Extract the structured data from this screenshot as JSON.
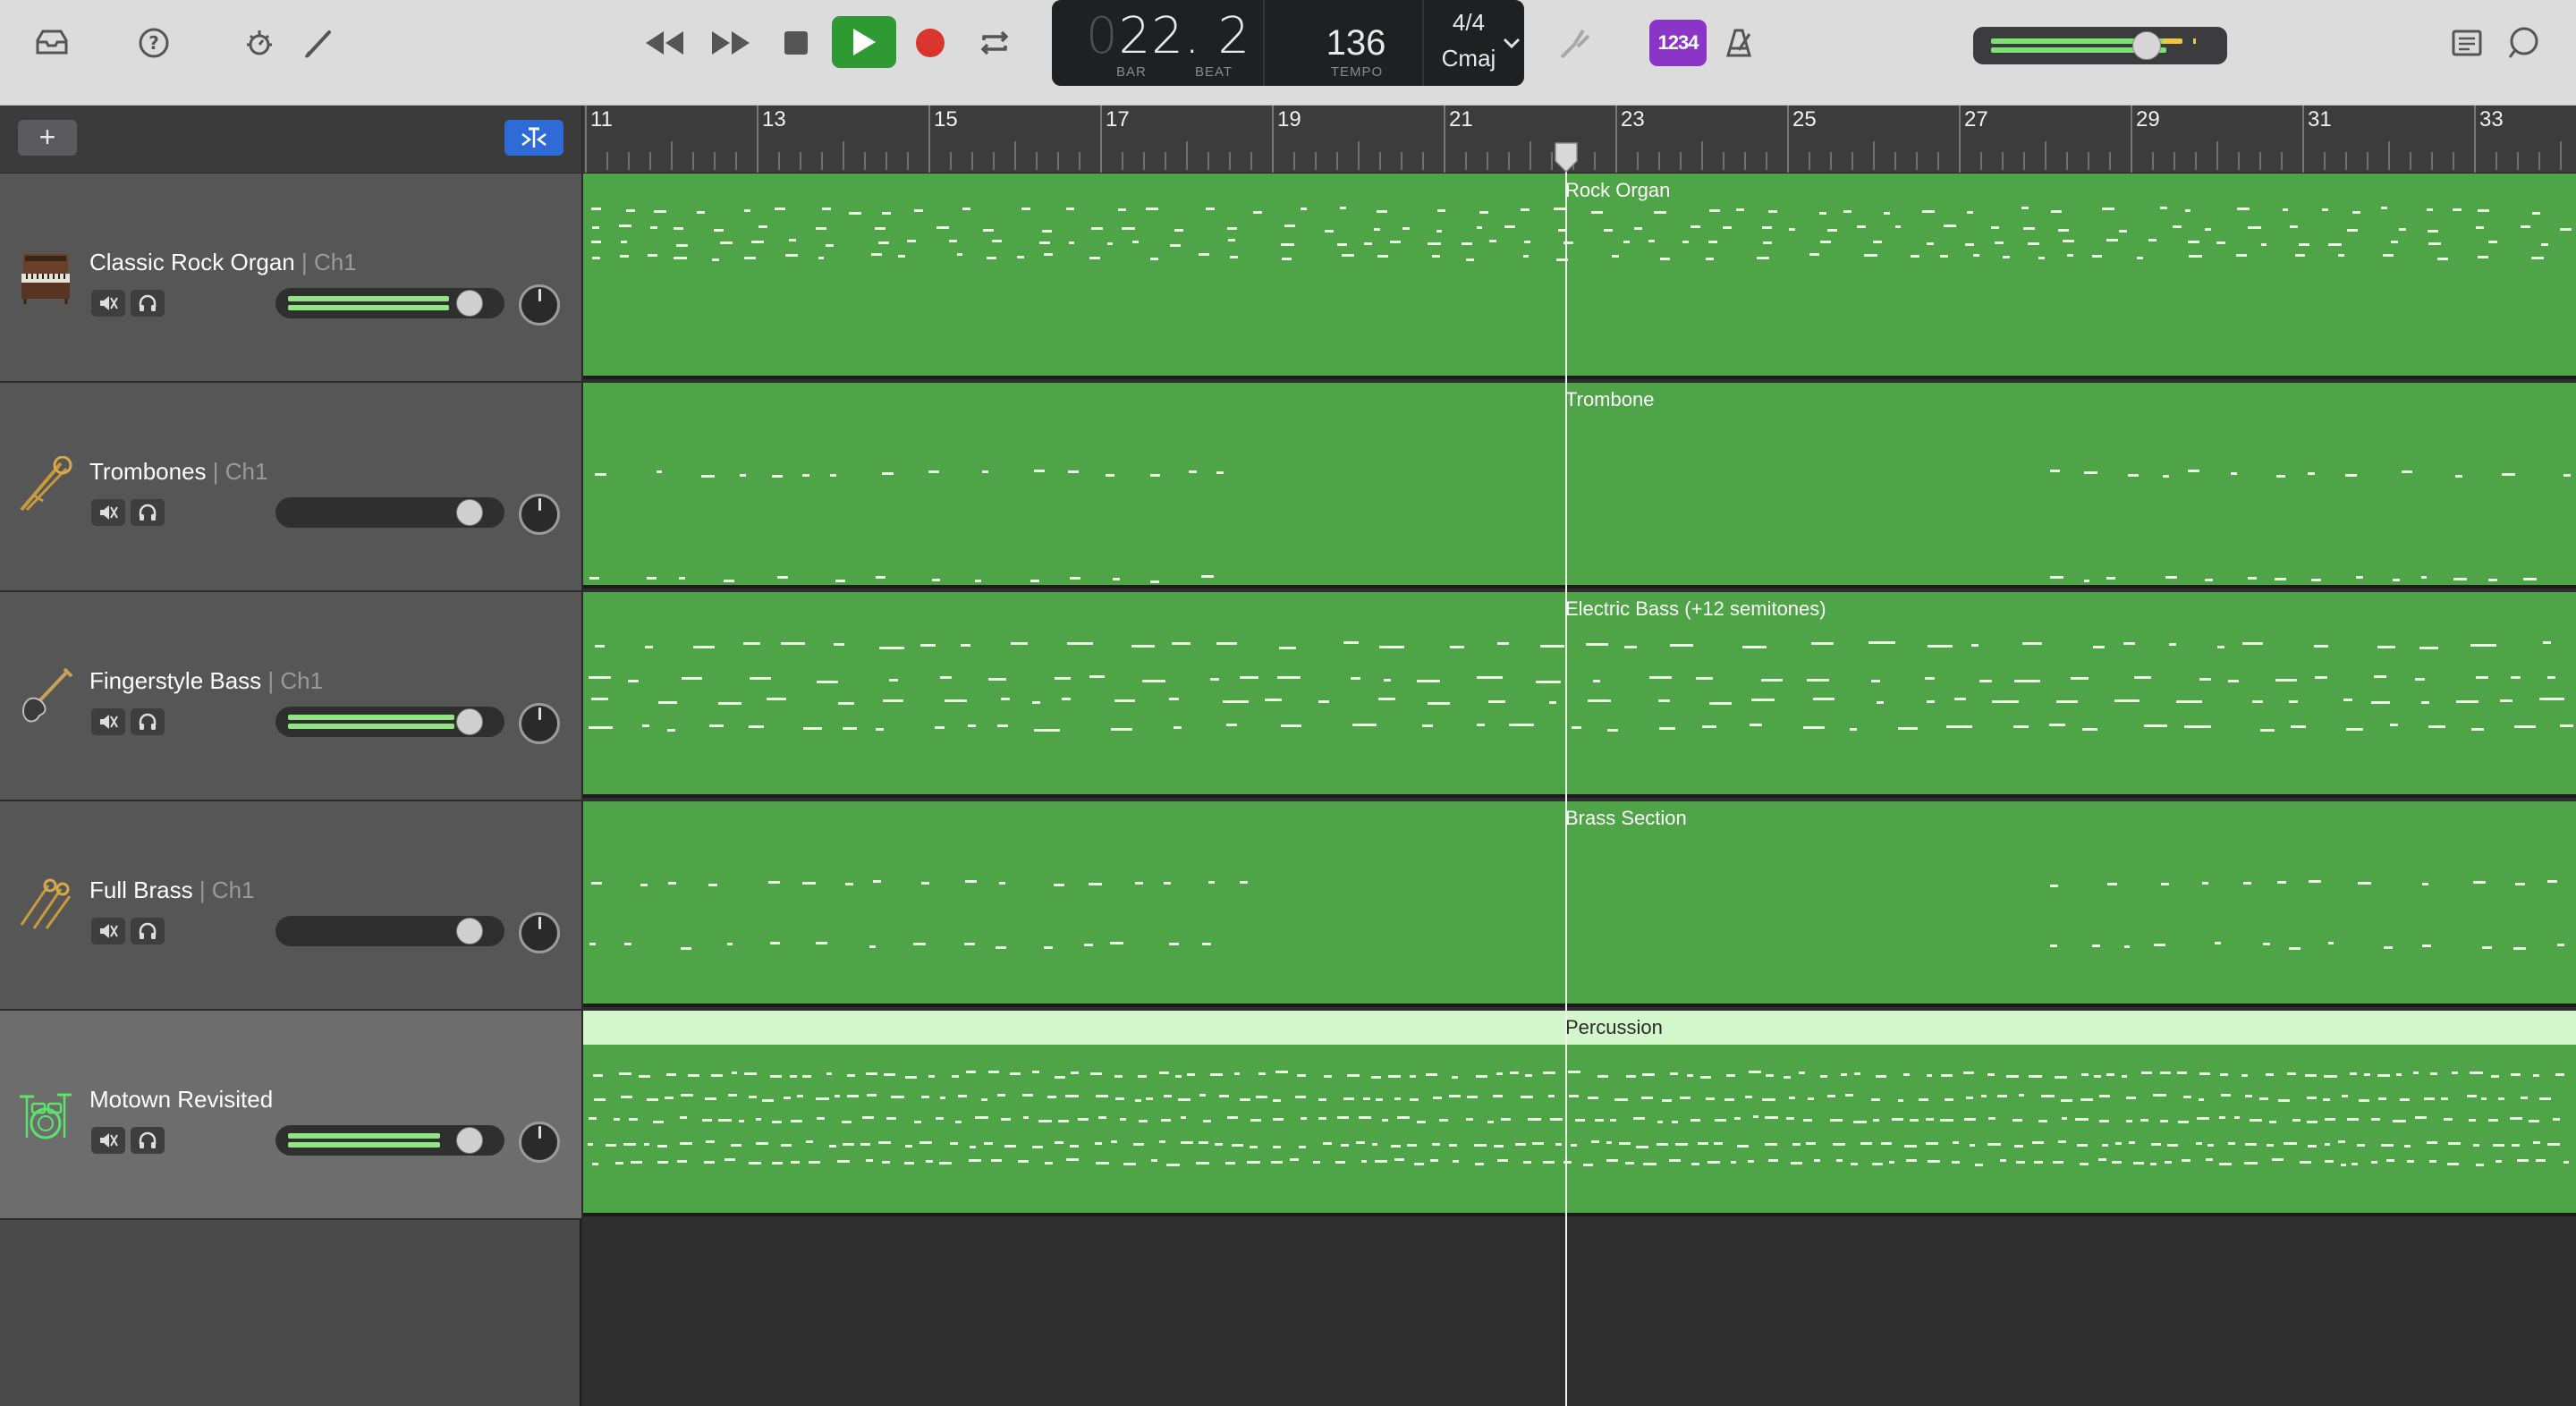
{
  "control_bar": {
    "icons": [
      "library-icon",
      "help-icon",
      "smart-controls-icon",
      "editors-icon",
      "rewind-icon",
      "fast-forward-icon",
      "stop-icon",
      "play-icon",
      "record-icon",
      "cycle-icon",
      "tuner-icon",
      "metronome-icon",
      "notepad-icon",
      "loops-icon"
    ],
    "lcd": {
      "bar_dim": "0",
      "position": "22. 2",
      "bar_label": "BAR",
      "beat_label": "BEAT",
      "tempo": "136",
      "tempo_label": "TEMPO",
      "time_signature": "4/4",
      "key": "Cmaj"
    },
    "count_in": "1234",
    "accent_color": "#8a35c7",
    "play_color": "#2f9a34",
    "record_color": "#d9352d",
    "master_volume_level": 0.71
  },
  "tracks_header": {
    "add_button": "+"
  },
  "tracks": [
    {
      "name": "Classic Rock Organ",
      "channel": "| Ch1",
      "icon": "organ-icon",
      "volume_level": 0.88,
      "meter": 0.83,
      "selected": false
    },
    {
      "name": "Trombones",
      "channel": "| Ch1",
      "icon": "trombone-icon",
      "volume_level": 0.88,
      "meter": 0,
      "selected": false
    },
    {
      "name": "Fingerstyle Bass",
      "channel": "| Ch1",
      "icon": "bass-guitar-icon",
      "volume_level": 0.88,
      "meter": 0.86,
      "selected": false
    },
    {
      "name": "Full Brass",
      "channel": "| Ch1",
      "icon": "brass-icon",
      "volume_level": 0.88,
      "meter": 0,
      "selected": false
    },
    {
      "name": "Motown Revisited",
      "channel": "",
      "icon": "drum-kit-icon",
      "volume_level": 0.88,
      "meter": 0.79,
      "selected": true
    }
  ],
  "ruler": {
    "bars": [
      "11",
      "13",
      "15",
      "17",
      "19",
      "21",
      "23",
      "25",
      "27",
      "29",
      "31",
      "33"
    ]
  },
  "regions": [
    {
      "label": "Rock Organ",
      "color": "#4ea446"
    },
    {
      "label": "Trombone",
      "color": "#4ea446"
    },
    {
      "label": "Electric Bass (+12 semitones)",
      "color": "#4ea446"
    },
    {
      "label": "Brass Section",
      "color": "#4ea446"
    },
    {
      "label": "Percussion",
      "color": "#4ea446"
    }
  ]
}
